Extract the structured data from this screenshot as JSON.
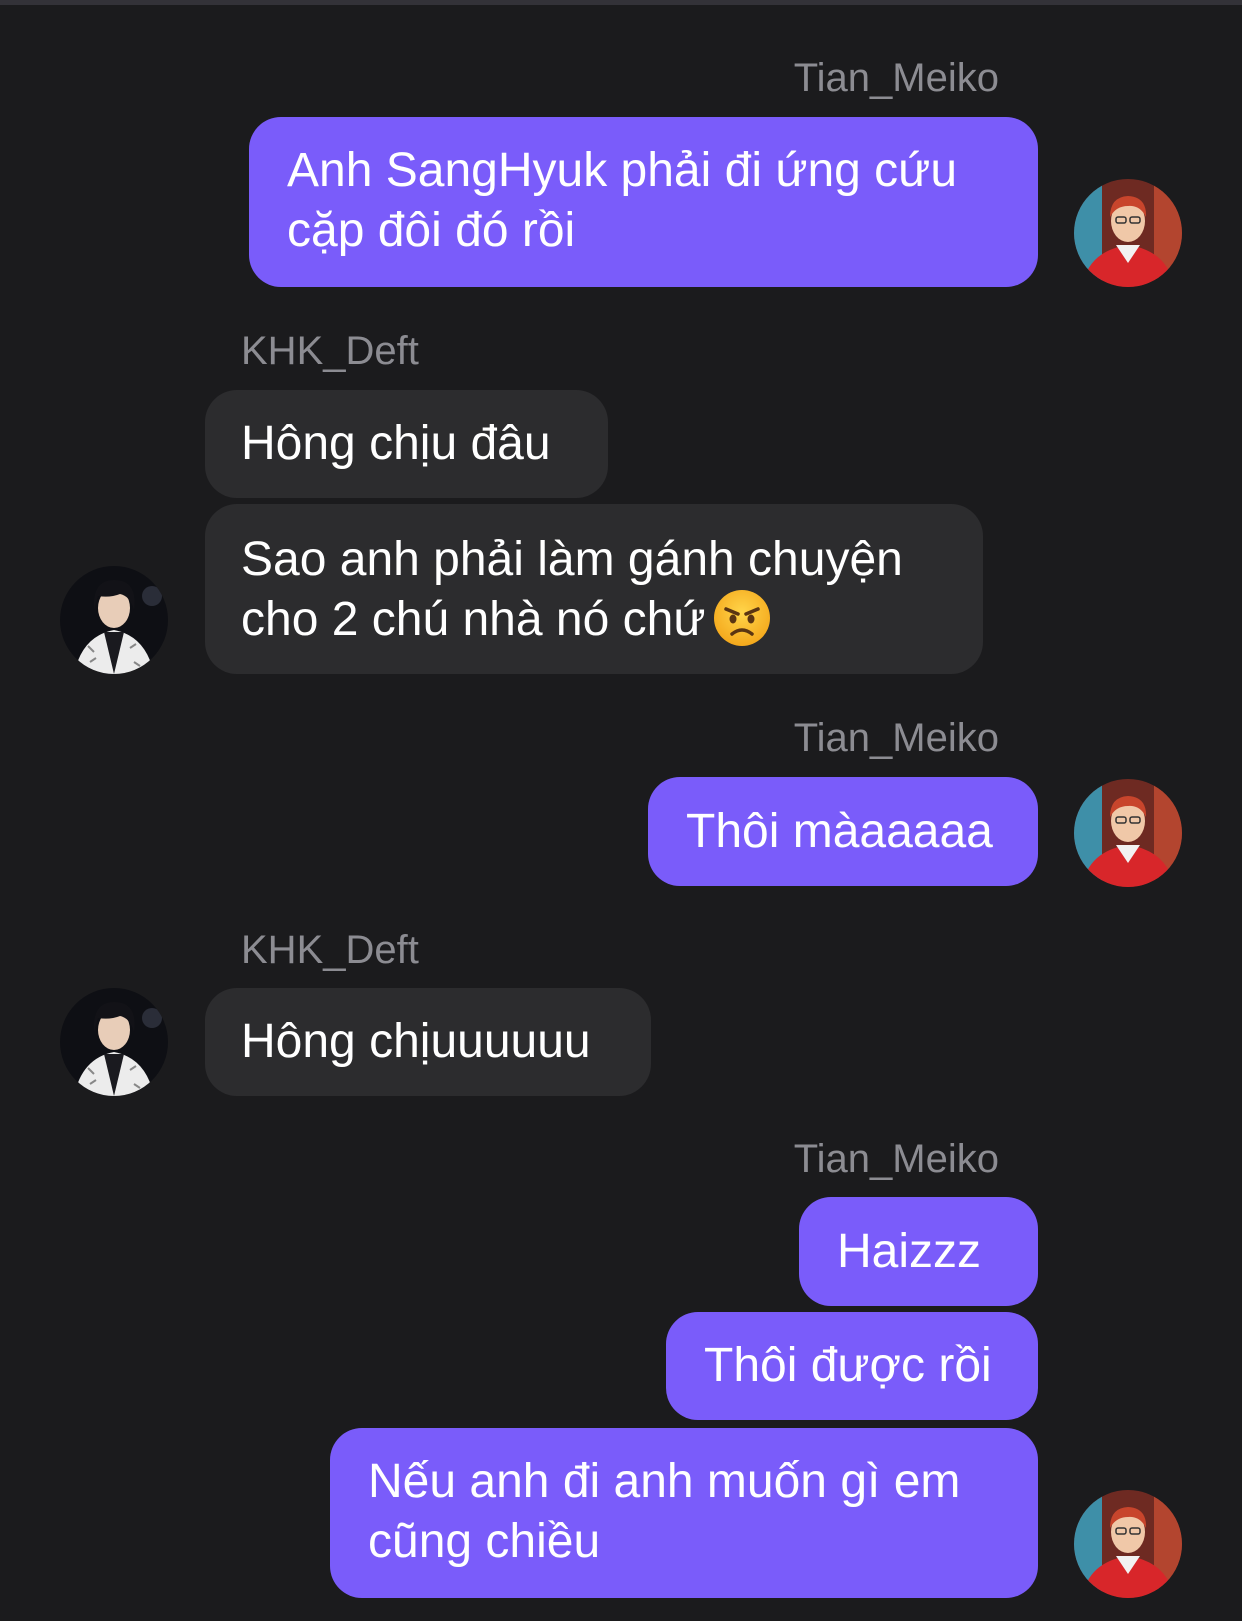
{
  "users": {
    "me": {
      "name": "Tian_Meiko",
      "avatar_icon": "user-avatar-red-jacket"
    },
    "them": {
      "name": "KHK_Deft",
      "avatar_icon": "user-avatar-white-jacket"
    }
  },
  "colors": {
    "background": "#1b1b1d",
    "outgoing_bubble": "#7a5cfa",
    "incoming_bubble": "#2c2c2e",
    "sender_name": "#8c8c92"
  },
  "messages": [
    {
      "sender": "Tian_Meiko",
      "lines": [
        "Anh SangHyuk phải đi ứng cứu",
        "cặp đôi đó rồi"
      ]
    },
    {
      "sender": "KHK_Deft",
      "lines": [
        "Hông chịu đâu"
      ]
    },
    {
      "sender": "KHK_Deft",
      "lines": [
        "Sao anh phải làm gánh chuyện",
        "cho 2 chú nhà nó chứ"
      ],
      "emoji": "angry-face-emoji"
    },
    {
      "sender": "Tian_Meiko",
      "lines": [
        "Thôi màaaaaa"
      ]
    },
    {
      "sender": "KHK_Deft",
      "lines": [
        "Hông chịuuuuuu"
      ]
    },
    {
      "sender": "Tian_Meiko",
      "lines": [
        "Haizzz"
      ]
    },
    {
      "sender": "Tian_Meiko",
      "lines": [
        "Thôi được rồi"
      ]
    },
    {
      "sender": "Tian_Meiko",
      "lines": [
        "Nếu anh đi anh muốn gì em",
        "cũng chiều"
      ]
    }
  ]
}
